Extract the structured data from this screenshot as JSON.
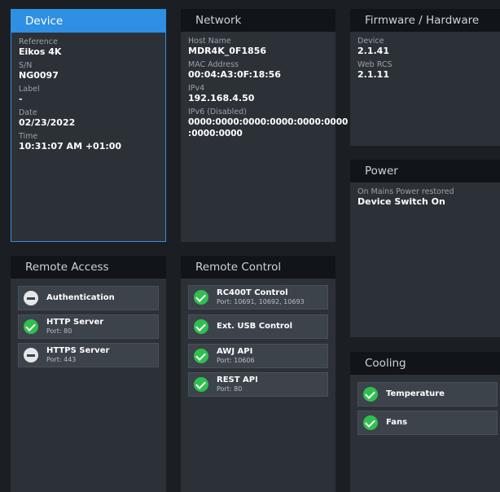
{
  "device": {
    "title": "Device",
    "fields": [
      {
        "label": "Reference",
        "value": "Eikos 4K"
      },
      {
        "label": "S/N",
        "value": "NG0097"
      },
      {
        "label": "Label",
        "value": "-"
      },
      {
        "label": "Date",
        "value": "02/23/2022"
      },
      {
        "label": "Time",
        "value": "10:31:07 AM +01:00"
      }
    ]
  },
  "network": {
    "title": "Network",
    "fields": [
      {
        "label": "Host Name",
        "value": "MDR4K_0F1856"
      },
      {
        "label": "MAC Address",
        "value": "00:04:A3:0F:18:56"
      },
      {
        "label": "IPv4",
        "value": "192.168.4.50"
      },
      {
        "label": "IPv6 (Disabled)",
        "value": "0000:0000:0000:0000:0000:0000\n:0000:0000"
      }
    ]
  },
  "firmware": {
    "title": "Firmware / Hardware",
    "fields": [
      {
        "label": "Device",
        "value": "2.1.41"
      },
      {
        "label": "Web RCS",
        "value": "2.1.11"
      }
    ]
  },
  "power": {
    "title": "Power",
    "fields": [
      {
        "label": "On Mains Power restored",
        "value": "Device Switch On"
      }
    ]
  },
  "remote_access": {
    "title": "Remote Access",
    "items": [
      {
        "name": "Authentication",
        "sub": "",
        "status": "off",
        "icon": "minus-circle-icon"
      },
      {
        "name": "HTTP Server",
        "sub": "Port: 80",
        "status": "ok",
        "icon": "check-circle-icon"
      },
      {
        "name": "HTTPS Server",
        "sub": "Port: 443",
        "status": "off",
        "icon": "minus-circle-icon"
      }
    ]
  },
  "remote_control": {
    "title": "Remote Control",
    "items": [
      {
        "name": "RC400T Control",
        "sub": "Port: 10691, 10692, 10693",
        "status": "ok",
        "icon": "check-circle-icon"
      },
      {
        "name": "Ext. USB Control",
        "sub": "",
        "status": "ok",
        "icon": "check-circle-icon"
      },
      {
        "name": "AWJ API",
        "sub": "Port: 10606",
        "status": "ok",
        "icon": "check-circle-icon"
      },
      {
        "name": "REST API",
        "sub": "Port: 80",
        "status": "ok",
        "icon": "check-circle-icon"
      }
    ]
  },
  "cooling": {
    "title": "Cooling",
    "items": [
      {
        "name": "Temperature",
        "sub": "",
        "status": "ok",
        "icon": "check-circle-icon"
      },
      {
        "name": "Fans",
        "sub": "",
        "status": "ok",
        "icon": "check-circle-icon"
      }
    ]
  },
  "colors": {
    "accent": "#2f8fe3",
    "ok": "#2fbf4f",
    "panel": "#2c3137",
    "header": "#111419",
    "background": "#1b1f24"
  }
}
